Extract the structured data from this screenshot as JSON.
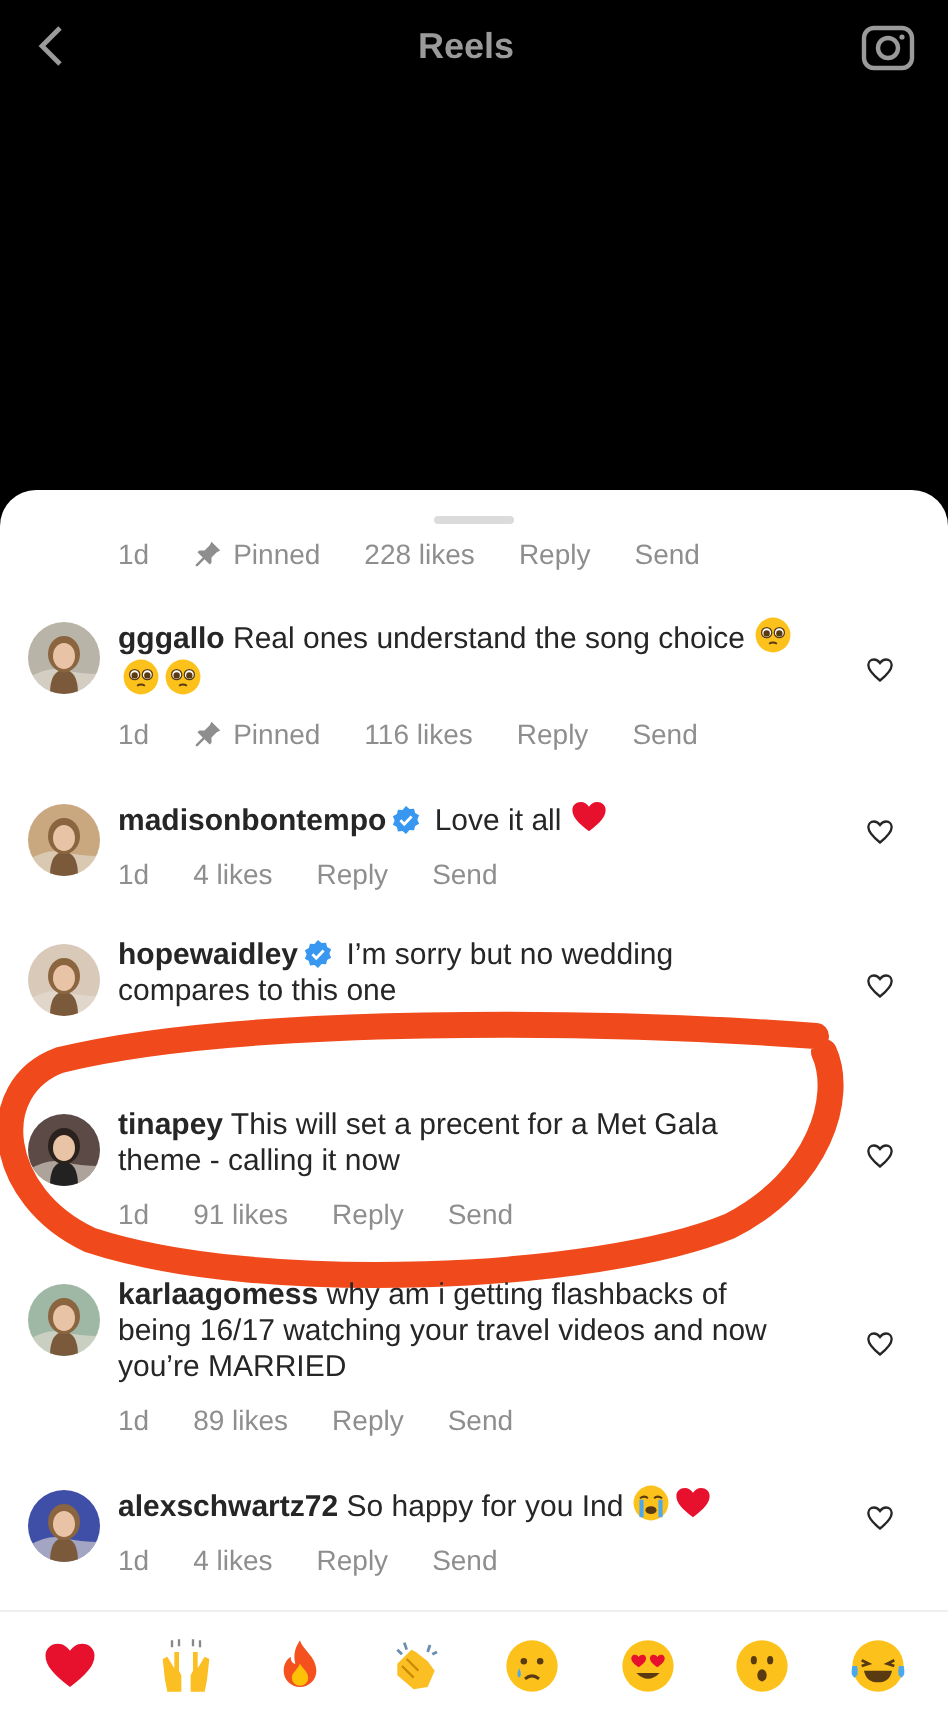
{
  "header": {
    "title": "Reels"
  },
  "partial_meta": {
    "time": "1d",
    "pin": "Pinned",
    "likes": "228 likes",
    "reply": "Reply",
    "send": "Send"
  },
  "comments": [
    {
      "username": "gggallo",
      "verified": false,
      "text": "Real ones understand the song choice",
      "emoji": [
        {
          "kind": "pleading"
        },
        {
          "kind": "pleading"
        },
        {
          "kind": "pleading"
        }
      ],
      "time": "1d",
      "pin": "Pinned",
      "likes": "116 likes",
      "reply": "Reply",
      "send": "Send",
      "highlighted": false
    },
    {
      "username": "madisonbontempo",
      "verified": true,
      "text": "Love it all",
      "emoji": [
        {
          "kind": "heart"
        }
      ],
      "time": "1d",
      "likes": "4 likes",
      "reply": "Reply",
      "send": "Send",
      "highlighted": false
    },
    {
      "username": "hopewaidley",
      "verified": true,
      "text": "I’m sorry but no wedding compares to this one",
      "highlighted": false
    },
    {
      "username": "tinapey",
      "verified": false,
      "text": "This will set a precent for a Met Gala theme - calling it now",
      "time": "1d",
      "likes": "91 likes",
      "reply": "Reply",
      "send": "Send",
      "highlighted": true
    },
    {
      "username": "karlaagomess",
      "verified": false,
      "text": "why am i getting flashbacks of being 16/17 watching your travel videos and now you’re MARRIED",
      "time": "1d",
      "likes": "89 likes",
      "reply": "Reply",
      "send": "Send",
      "highlighted": false
    },
    {
      "username": "alexschwartz72",
      "verified": false,
      "text": "So happy for you Ind",
      "emoji": [
        {
          "kind": "crying"
        },
        {
          "kind": "heart"
        }
      ],
      "time": "1d",
      "likes": "4 likes",
      "reply": "Reply",
      "send": "Send",
      "highlighted": false
    }
  ],
  "reactions": [
    {
      "kind": "heart"
    },
    {
      "kind": "raised-hands"
    },
    {
      "kind": "fire"
    },
    {
      "kind": "clap"
    },
    {
      "kind": "sad-tear"
    },
    {
      "kind": "heart-eyes"
    },
    {
      "kind": "surprised"
    },
    {
      "kind": "laughing"
    }
  ]
}
